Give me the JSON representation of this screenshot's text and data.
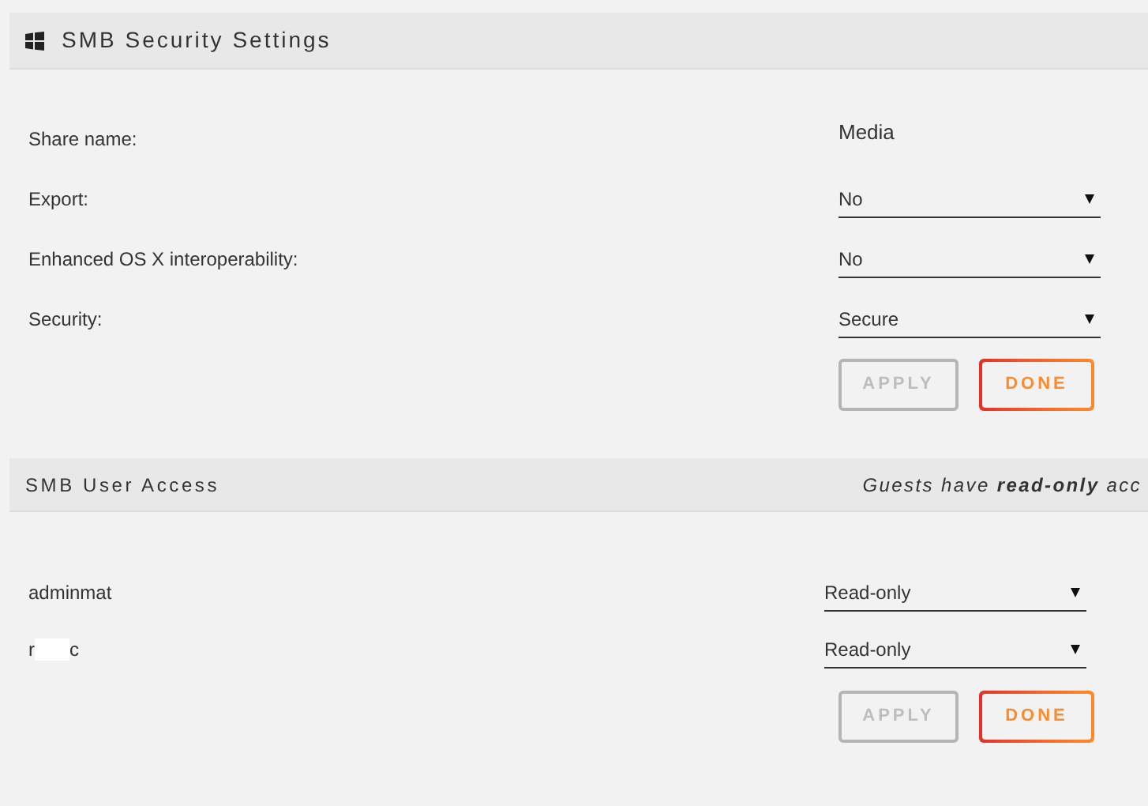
{
  "security_section": {
    "title": "SMB Security Settings",
    "rows": [
      {
        "label": "Share name:",
        "kind": "text",
        "value": "Media"
      },
      {
        "label": "Export:",
        "kind": "select",
        "value": "No"
      },
      {
        "label": "Enhanced OS X interoperability:",
        "kind": "select",
        "value": "No"
      },
      {
        "label": "Security:",
        "kind": "select",
        "value": "Secure"
      }
    ],
    "buttons": [
      {
        "label": "APPLY",
        "disabled": true
      },
      {
        "label": "DONE",
        "disabled": false
      }
    ]
  },
  "user_access_section": {
    "title": "SMB User Access",
    "note": "Guests have **read-only** acc",
    "users": [
      {
        "name_start": "adminmat",
        "redacted": false,
        "access": "Read-only"
      },
      {
        "name_start": "r",
        "name_end": "c",
        "redacted": true,
        "access": "Read-only"
      }
    ],
    "buttons": [
      {
        "label": "APPLY",
        "disabled": true
      },
      {
        "label": "DONE",
        "disabled": false
      }
    ]
  }
}
